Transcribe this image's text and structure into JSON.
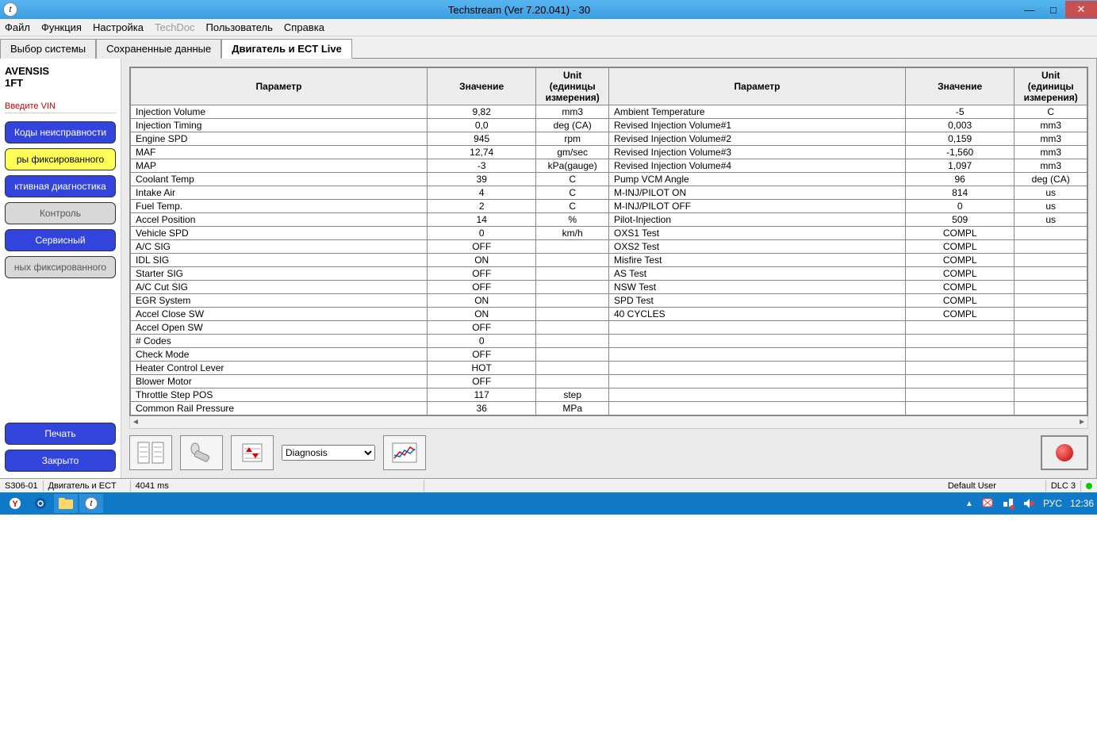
{
  "window": {
    "title": "Techstream (Ver 7.20.041) - 30"
  },
  "menu": {
    "file": "Файл",
    "function": "Функция",
    "setup": "Настройка",
    "techdoc": "TechDoc",
    "user": "Пользователь",
    "help": "Справка"
  },
  "tabs": {
    "t1": "Выбор системы",
    "t2": "Сохраненные данные",
    "t3": "Двигатель и ECT Live"
  },
  "sidebar": {
    "vehicle1": "AVENSIS",
    "vehicle2": "1FT",
    "vin_label": "Введите VIN",
    "btn_codes": "Коды неисправности",
    "btn_freeze": "ры фиксированного",
    "btn_active": "ктивная диагностика",
    "btn_control": "Контроль",
    "btn_service": "Сервисный",
    "btn_freeze2": "ных фиксированного",
    "btn_print": "Печать",
    "btn_close": "Закрыто"
  },
  "table": {
    "h_param": "Параметр",
    "h_value": "Значение",
    "h_unit": "Unit (единицы измерения)",
    "left": [
      {
        "p": "Injection Volume",
        "v": "9,82",
        "u": "mm3"
      },
      {
        "p": "Injection Timing",
        "v": "0,0",
        "u": "deg (CA)"
      },
      {
        "p": "Engine SPD",
        "v": "945",
        "u": "rpm"
      },
      {
        "p": "MAF",
        "v": "12,74",
        "u": "gm/sec"
      },
      {
        "p": "MAP",
        "v": "-3",
        "u": "kPa(gauge)"
      },
      {
        "p": "Coolant Temp",
        "v": "39",
        "u": "C"
      },
      {
        "p": "Intake Air",
        "v": "4",
        "u": "C"
      },
      {
        "p": "Fuel Temp.",
        "v": "2",
        "u": "C"
      },
      {
        "p": "Accel Position",
        "v": "14",
        "u": "%"
      },
      {
        "p": "Vehicle SPD",
        "v": "0",
        "u": "km/h"
      },
      {
        "p": "A/C SIG",
        "v": "OFF",
        "u": ""
      },
      {
        "p": "IDL SIG",
        "v": "ON",
        "u": ""
      },
      {
        "p": "Starter SIG",
        "v": "OFF",
        "u": ""
      },
      {
        "p": "A/C Cut SIG",
        "v": "OFF",
        "u": ""
      },
      {
        "p": "EGR System",
        "v": "ON",
        "u": ""
      },
      {
        "p": "Accel Close SW",
        "v": "ON",
        "u": ""
      },
      {
        "p": "Accel Open SW",
        "v": "OFF",
        "u": ""
      },
      {
        "p": "# Codes",
        "v": "0",
        "u": ""
      },
      {
        "p": "Check Mode",
        "v": "OFF",
        "u": ""
      },
      {
        "p": "Heater Control Lever",
        "v": "HOT",
        "u": ""
      },
      {
        "p": "Blower Motor",
        "v": "OFF",
        "u": ""
      },
      {
        "p": "Throttle Step POS",
        "v": "117",
        "u": "step"
      },
      {
        "p": "Common Rail Pressure",
        "v": "36",
        "u": "MPa"
      }
    ],
    "right": [
      {
        "p": "Ambient Temperature",
        "v": "-5",
        "u": "C"
      },
      {
        "p": "Revised Injection Volume#1",
        "v": "0,003",
        "u": "mm3"
      },
      {
        "p": "Revised Injection Volume#2",
        "v": "0,159",
        "u": "mm3"
      },
      {
        "p": "Revised Injection Volume#3",
        "v": "-1,560",
        "u": "mm3"
      },
      {
        "p": "Revised Injection Volume#4",
        "v": "1,097",
        "u": "mm3"
      },
      {
        "p": "Pump VCM Angle",
        "v": "96",
        "u": "deg (CA)"
      },
      {
        "p": "M-INJ/PILOT ON",
        "v": "814",
        "u": "us"
      },
      {
        "p": "M-INJ/PILOT OFF",
        "v": "0",
        "u": "us"
      },
      {
        "p": "Pilot-Injection",
        "v": "509",
        "u": "us"
      },
      {
        "p": "OXS1 Test",
        "v": "COMPL",
        "u": ""
      },
      {
        "p": "OXS2 Test",
        "v": "COMPL",
        "u": ""
      },
      {
        "p": "Misfire Test",
        "v": "COMPL",
        "u": ""
      },
      {
        "p": "AS Test",
        "v": "COMPL",
        "u": ""
      },
      {
        "p": "NSW Test",
        "v": "COMPL",
        "u": ""
      },
      {
        "p": "SPD Test",
        "v": "COMPL",
        "u": ""
      },
      {
        "p": "40 CYCLES",
        "v": "COMPL",
        "u": ""
      },
      {
        "p": "",
        "v": "",
        "u": ""
      },
      {
        "p": "",
        "v": "",
        "u": ""
      },
      {
        "p": "",
        "v": "",
        "u": ""
      },
      {
        "p": "",
        "v": "",
        "u": ""
      },
      {
        "p": "",
        "v": "",
        "u": ""
      },
      {
        "p": "",
        "v": "",
        "u": ""
      },
      {
        "p": "",
        "v": "",
        "u": ""
      }
    ]
  },
  "toolbar": {
    "select_value": "Diagnosis"
  },
  "status": {
    "s1": "S306-01",
    "s2": "Двигатель и ECT",
    "s3": "4041 ms",
    "user": "Default User",
    "dlc": "DLC 3"
  },
  "taskbar": {
    "lang": "РУС",
    "time": "12:36"
  }
}
